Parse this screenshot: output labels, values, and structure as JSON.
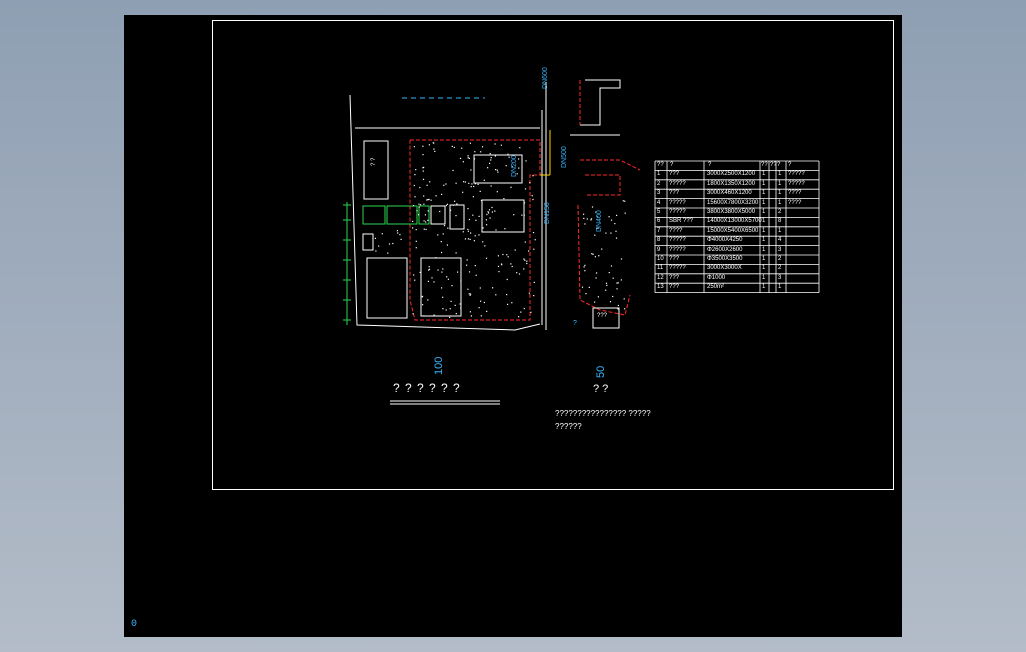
{
  "drawing": {
    "pipe_labels": [
      "DN600",
      "DN500",
      "DN200",
      "DN150",
      "DN400",
      "DN150"
    ],
    "pipe_label_colors": "#39b6ff",
    "scale_left": {
      "value": "100",
      "text": "? ? ? ? ? ?"
    },
    "scale_right": {
      "value": "50",
      "text": "? ?"
    },
    "note_lines": [
      "???????????????? ?????",
      "??????"
    ],
    "small_labels": {
      "tank_label": "? ?",
      "box_label": "???",
      "marker": "?"
    }
  },
  "table": {
    "headers": [
      "??",
      "?",
      "?",
      "??",
      "??",
      "?",
      "?"
    ],
    "rows": [
      [
        "1",
        "???",
        "3000X2500X1200",
        "1",
        "1",
        "?????"
      ],
      [
        "2",
        "?????",
        "1800X1350X1200",
        "1",
        "1",
        "?????"
      ],
      [
        "3",
        "???",
        "3000X460X1200",
        "1",
        "1",
        "????"
      ],
      [
        "4",
        "?????",
        "15600X7800X3200",
        "1",
        "1",
        "????"
      ],
      [
        "5",
        "?????",
        "3800X3800X5000",
        "1",
        "2",
        ""
      ],
      [
        "6",
        "SBR ???",
        "14000X13000X5700",
        "1",
        "8",
        ""
      ],
      [
        "7",
        "????",
        "15000X5400X6500",
        "1",
        "1",
        ""
      ],
      [
        "8",
        "?????",
        "Φ4000X4250",
        "1",
        "4",
        ""
      ],
      [
        "9",
        "?????",
        "Φ2600X2600",
        "1",
        "3",
        ""
      ],
      [
        "10",
        "???",
        "Φ3500X3500",
        "1",
        "2",
        ""
      ],
      [
        "11",
        "?????",
        "3000X3000X",
        "1",
        "2",
        ""
      ],
      [
        "12",
        "???",
        "Φ1000",
        "1",
        "3",
        ""
      ],
      [
        "13",
        "???",
        "250m²",
        "1",
        "1",
        ""
      ]
    ]
  },
  "status": {
    "ucs": "0"
  },
  "colors": {
    "background": "#000000",
    "frame": "#ffffff",
    "boundary_red": "#ff2a2a",
    "dimension_green": "#2bd64b",
    "text_cyan": "#39b6ff"
  }
}
